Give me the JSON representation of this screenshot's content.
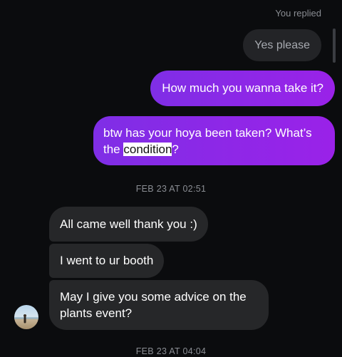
{
  "thread": {
    "replied_label": "You replied",
    "reply_quote": "Yes please",
    "sent_messages": [
      "How much you wanna take it?",
      {
        "before": "btw has your hoya been taken? What’s the ",
        "highlighted": "condition",
        "after": "?"
      }
    ],
    "timestamp_1": "FEB 23 AT 02:51",
    "received_messages": [
      "All came well thank you :)",
      "I went to ur booth",
      "May I give you some advice on the plants event?"
    ],
    "timestamp_2": "FEB 23 AT 04:04"
  }
}
